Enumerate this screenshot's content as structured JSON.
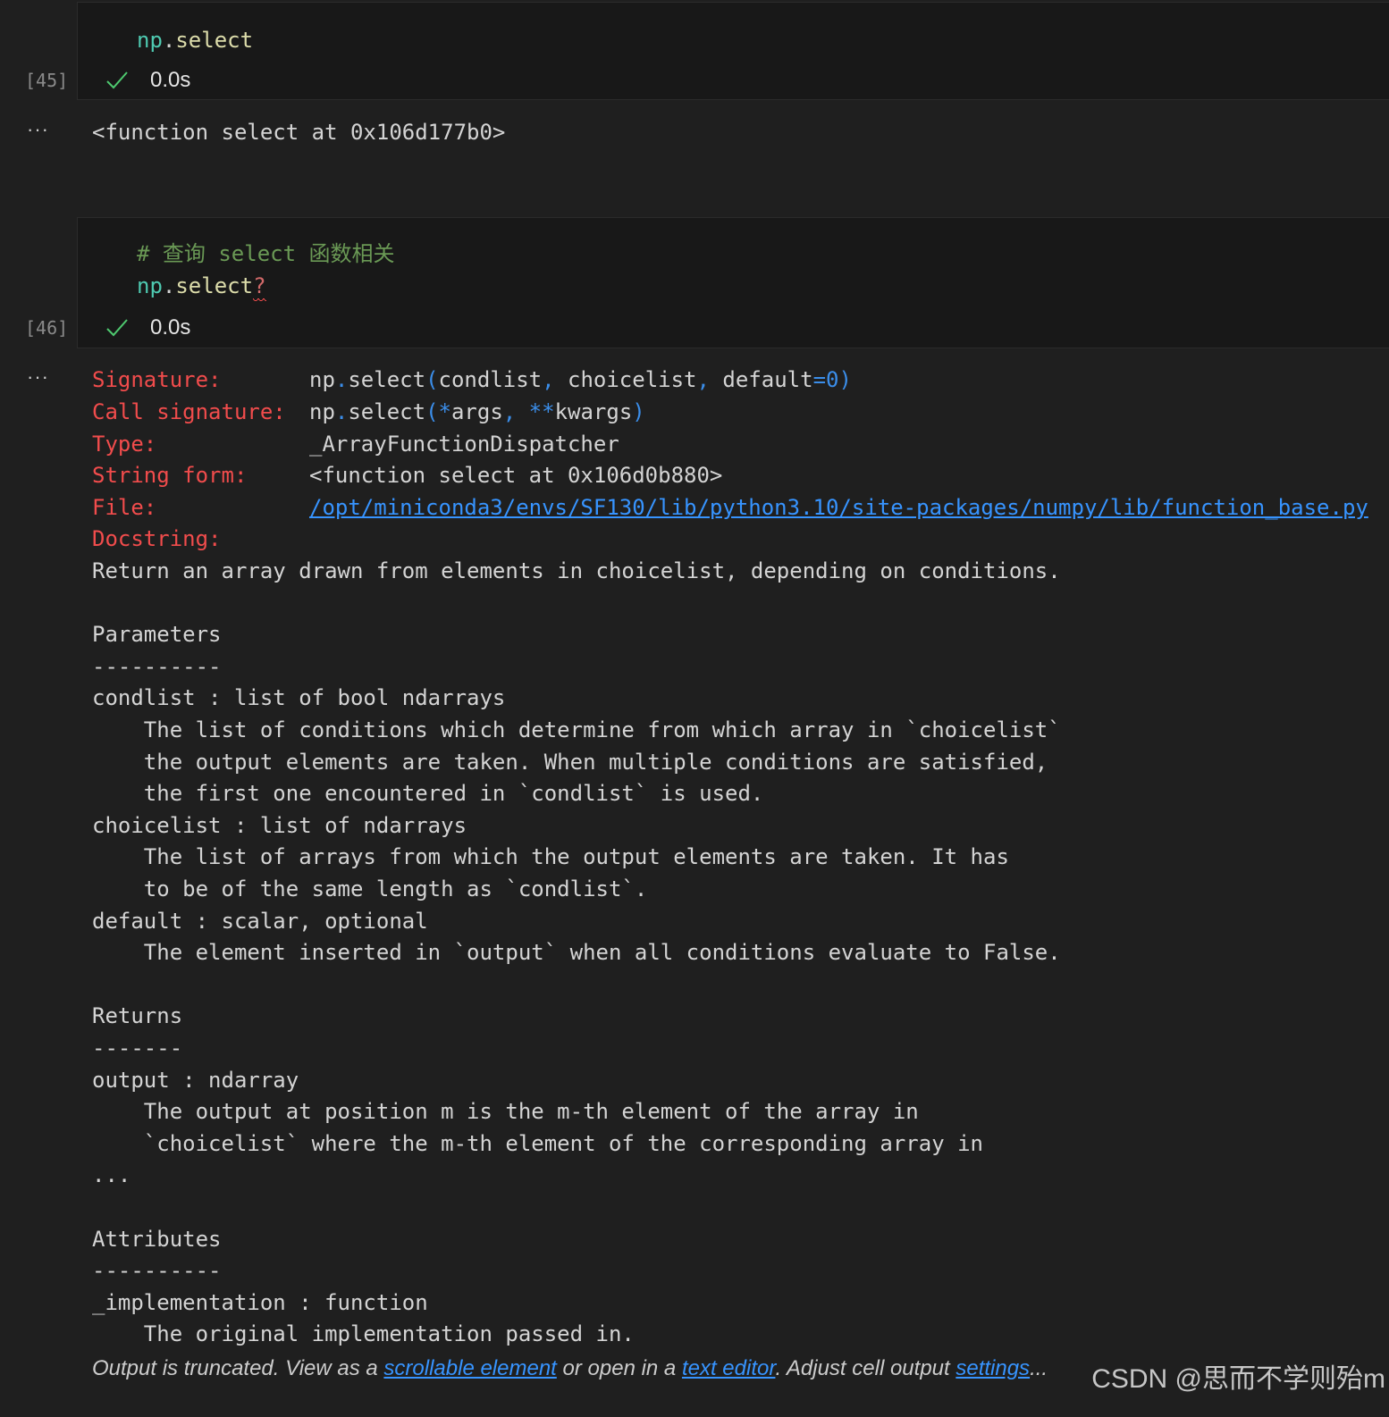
{
  "cells": [
    {
      "exec_count": "[45]",
      "code": {
        "mod": "np",
        "dot": ".",
        "fn": "select"
      },
      "status_time": "0.0s",
      "output_ellipsis": "···",
      "output_text": "<function select at 0x106d177b0>"
    },
    {
      "exec_count": "[46]",
      "comment": "# 查询 select 函数相关",
      "code": {
        "mod": "np",
        "dot": ".",
        "fn": "select",
        "q": "?"
      },
      "status_time": "0.0s",
      "output_ellipsis": "···"
    }
  ],
  "inspect": {
    "signature": {
      "label": "Signature:",
      "mod": "np",
      "dot": ".",
      "fn": "select",
      "open": "(",
      "arg1": "condlist",
      "comma1": ",",
      "arg2": " choicelist",
      "comma2": ",",
      "arg3": " default",
      "eq": "=",
      "val": "0",
      "close": ")"
    },
    "call_signature": {
      "label": "Call signature:",
      "mod": "np",
      "dot": ".",
      "fn": "select",
      "open": "(",
      "star1": "*",
      "arg1": "args",
      "comma": ",",
      "star2": " **",
      "arg2": "kwargs",
      "close": ")"
    },
    "type": {
      "label": "Type:",
      "value": "_ArrayFunctionDispatcher"
    },
    "string_form": {
      "label": "String form:",
      "value": "<function select at 0x106d0b880>"
    },
    "file": {
      "label": "File:",
      "value": "/opt/miniconda3/envs/SF130/lib/python3.10/site-packages/numpy/lib/function_base.py"
    },
    "docstring_label": "Docstring:",
    "doc_lines": [
      "Return an array drawn from elements in choicelist, depending on conditions.",
      "",
      "Parameters",
      "----------",
      "condlist : list of bool ndarrays",
      "    The list of conditions which determine from which array in `choicelist`",
      "    the output elements are taken. When multiple conditions are satisfied,",
      "    the first one encountered in `condlist` is used.",
      "choicelist : list of ndarrays",
      "    The list of arrays from which the output elements are taken. It has",
      "    to be of the same length as `condlist`.",
      "default : scalar, optional",
      "    The element inserted in `output` when all conditions evaluate to False.",
      "",
      "Returns",
      "-------",
      "output : ndarray",
      "    The output at position m is the m-th element of the array in",
      "    `choicelist` where the m-th element of the corresponding array in",
      "...",
      "",
      "Attributes",
      "----------",
      "_implementation : function",
      "    The original implementation passed in."
    ]
  },
  "footer": {
    "t1": "Output is truncated. View as a ",
    "link1": "scrollable element",
    "t2": " or open in a ",
    "link2": "text editor",
    "t3": ". Adjust cell output ",
    "link3": "settings",
    "t4": "..."
  },
  "watermark": "CSDN @思而不学则殆m",
  "colors": {
    "background": "#1f1f1f",
    "check": "#4ec96f",
    "label": "#f14c4c",
    "link": "#3794ff"
  }
}
